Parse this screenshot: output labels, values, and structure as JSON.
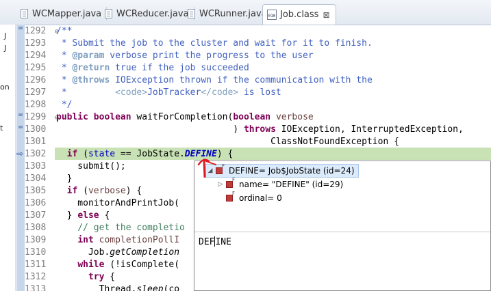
{
  "tabs": [
    {
      "label": "WCMapper.java",
      "active": false
    },
    {
      "label": "WCReducer.java",
      "active": false
    },
    {
      "label": "WCRunner.java",
      "active": false
    },
    {
      "label": "Job.class",
      "active": true
    }
  ],
  "tab_close_glyph": "⊠",
  "left_panel_fragments": [
    "J",
    "J",
    "on",
    "t"
  ],
  "gutter": {
    "lines": [
      "1292",
      "1293",
      "1294",
      "1295",
      "1296",
      "1297",
      "1298",
      "1299",
      "1300",
      "1301",
      "1302",
      "1303",
      "1304",
      "1305",
      "1306",
      "1307",
      "1308",
      "1309",
      "1310",
      "1311",
      "1312",
      "1313"
    ]
  },
  "code": {
    "l1292": "/**",
    "l1293": " * Submit the job to the cluster and wait for it to finish.",
    "l1294a": " * ",
    "l1294b": "@param",
    "l1294c": " verbose print the progress to the user",
    "l1295a": " * ",
    "l1295b": "@return",
    "l1295c": " true if the job succeeded",
    "l1296a": " * ",
    "l1296b": "@throws",
    "l1296c": " IOException thrown if the communication with the",
    "l1297a": " *         ",
    "l1297b": "<code>",
    "l1297c": "JobTracker",
    "l1297d": "</code>",
    "l1297e": " is lost",
    "l1298": " */",
    "l1299a": "public",
    "l1299b": " ",
    "l1299c": "boolean",
    "l1299d": " waitForCompletion(",
    "l1299e": "boolean",
    "l1299f": " ",
    "l1299g": "verbose",
    "l1300a": "                                 ) ",
    "l1300b": "throws",
    "l1300c": " IOException, InterruptedException,",
    "l1301": "                                        ClassNotFoundException {",
    "l1302a": "  ",
    "l1302b": "if",
    "l1302c": " (",
    "l1302d": "state",
    "l1302e": " == JobState.",
    "l1302f": "DEFINE",
    "l1302g": ") {",
    "l1303": "    submit();",
    "l1304": "  }",
    "l1305a": "  ",
    "l1305b": "if",
    "l1305c": " (",
    "l1305d": "verbose",
    "l1305e": ") {",
    "l1306": "    monitorAndPrintJob(",
    "l1307a": "  } ",
    "l1307b": "else",
    "l1307c": " {",
    "l1308a": "    ",
    "l1308b": "// get the completio",
    "l1309a": "    ",
    "l1309b": "int",
    "l1309c": " ",
    "l1309d": "completionPollI",
    "l1310a": "      Job.",
    "l1310b": "getCompletion",
    "l1311a": "    ",
    "l1311b": "while",
    "l1311c": " (!isComplete(",
    "l1312a": "      ",
    "l1312b": "try",
    "l1312c": " {",
    "l1313a": "        Thread.",
    "l1313b": "sleep",
    "l1313c": "(co"
  },
  "popup": {
    "root": "DEFINE= Job$JobState  (id=24)",
    "child_name": "name= \"DEFINE\" (id=29)",
    "child_ordinal": "ordinal= 0",
    "detail_before": "DEF",
    "detail_after": "INE"
  },
  "colors": {
    "annotation": "#e0191e",
    "highlight": "#c8e2b5",
    "keyword": "#7f0055",
    "comment": "#3f5fbf"
  }
}
